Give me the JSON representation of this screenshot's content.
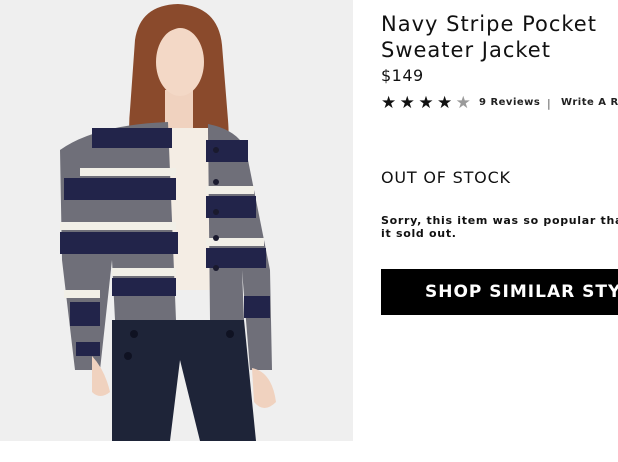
{
  "product": {
    "title_line1": "Navy Stripe Pocket",
    "title_line2": "Sweater Jacket",
    "price": "$149",
    "image_description": "model-wearing-striped-sweater-jacket"
  },
  "rating": {
    "value": 4,
    "max": 5,
    "reviews_label": "9 Reviews",
    "separator": "|",
    "write_label": "Write A Review"
  },
  "availability": {
    "status": "OUT OF STOCK",
    "message": "Sorry, this item was so popular that it sold out."
  },
  "actions": {
    "shop_similar_label": "SHOP SIMILAR STYLES"
  },
  "colors": {
    "button_bg": "#000000",
    "stripe_navy": "#1f2144",
    "stripe_grey": "#7d7c86",
    "stripe_ivory": "#f2f0e8"
  }
}
